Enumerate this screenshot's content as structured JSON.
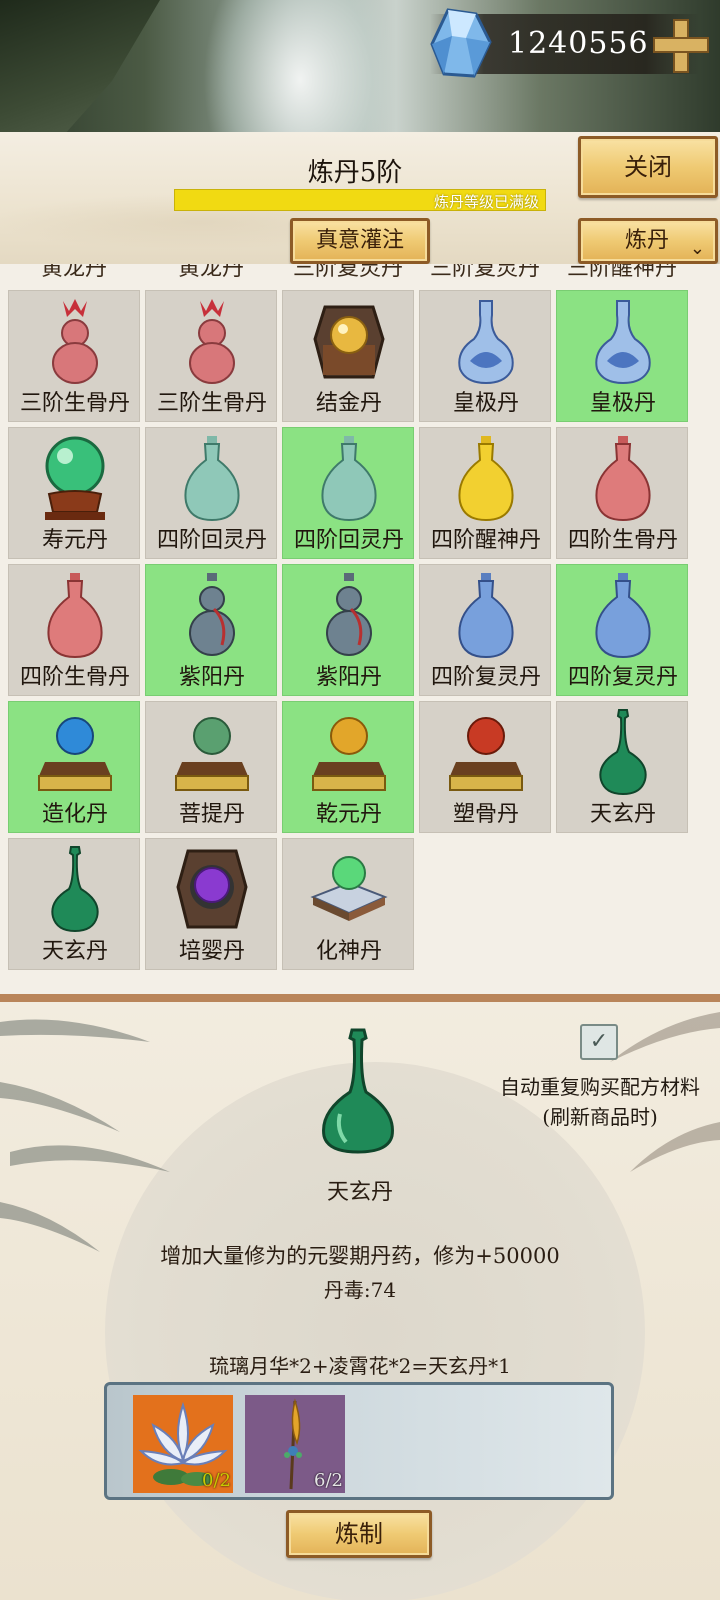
{
  "currency": {
    "value": "1240556",
    "icon": "gem-icon",
    "plus_icon": "plus-icon"
  },
  "header": {
    "title": "炼丹5阶",
    "progress_text": "炼丹等级已满级",
    "progress": 1.0,
    "close_label": "关闭",
    "infuse_label": "真意灌注",
    "mode_label": "炼丹"
  },
  "grid": {
    "partial_row": [
      "黄龙丹",
      "黄龙丹",
      "三阶复灵丹",
      "三阶复灵丹",
      "三阶醒神丹"
    ],
    "rows": [
      [
        {
          "name": "三阶生骨丹",
          "active": false,
          "icon": "red-gourd-icon"
        },
        {
          "name": "三阶生骨丹",
          "active": false,
          "icon": "red-gourd-icon"
        },
        {
          "name": "结金丹",
          "active": false,
          "icon": "gold-orb-box-icon"
        },
        {
          "name": "皇极丹",
          "active": false,
          "icon": "blue-porcelain-vase-icon"
        },
        {
          "name": "皇极丹",
          "active": true,
          "icon": "blue-porcelain-vase-icon"
        }
      ],
      [
        {
          "name": "寿元丹",
          "active": false,
          "icon": "jade-orb-stand-icon"
        },
        {
          "name": "四阶回灵丹",
          "active": false,
          "icon": "celadon-bottle-icon"
        },
        {
          "name": "四阶回灵丹",
          "active": true,
          "icon": "celadon-bottle-icon"
        },
        {
          "name": "四阶醒神丹",
          "active": false,
          "icon": "yellow-bottle-icon"
        },
        {
          "name": "四阶生骨丹",
          "active": false,
          "icon": "red-bottle-icon"
        }
      ],
      [
        {
          "name": "四阶生骨丹",
          "active": false,
          "icon": "red-bottle-icon"
        },
        {
          "name": "紫阳丹",
          "active": true,
          "icon": "gray-gourd-icon"
        },
        {
          "name": "紫阳丹",
          "active": true,
          "icon": "gray-gourd-icon"
        },
        {
          "name": "四阶复灵丹",
          "active": false,
          "icon": "blue-bottle-icon"
        },
        {
          "name": "四阶复灵丹",
          "active": true,
          "icon": "blue-bottle-icon"
        }
      ],
      [
        {
          "name": "造化丹",
          "active": true,
          "icon": "blue-orb-pedestal-icon"
        },
        {
          "name": "菩提丹",
          "active": false,
          "icon": "green-orb-pedestal-icon"
        },
        {
          "name": "乾元丹",
          "active": true,
          "icon": "gold-orb-pedestal-icon"
        },
        {
          "name": "塑骨丹",
          "active": false,
          "icon": "red-orb-pedestal-icon"
        },
        {
          "name": "天玄丹",
          "active": false,
          "icon": "green-vase-icon"
        }
      ],
      [
        {
          "name": "天玄丹",
          "active": false,
          "icon": "green-vase-icon"
        },
        {
          "name": "培婴丹",
          "active": false,
          "icon": "purple-orb-box-icon"
        },
        {
          "name": "化神丹",
          "active": false,
          "icon": "green-orb-cushion-icon"
        }
      ]
    ]
  },
  "detail": {
    "auto_label_line1": "自动重复购买配方材料",
    "auto_label_line2": "(刷新商品时)",
    "auto_checked": true,
    "product_name": "天玄丹",
    "description": "增加大量修为的元婴期丹药，修为+50000",
    "toxicity": "丹毒:74",
    "formula": "琉璃月华*2+凌霄花*2=天玄丹*1",
    "materials": [
      {
        "icon": "lotus-flower-icon",
        "count": "0/2",
        "color": "#e3711c"
      },
      {
        "icon": "spear-herb-icon",
        "count": "6/2",
        "color": "#7c5a88"
      }
    ],
    "craft_label": "炼制"
  }
}
